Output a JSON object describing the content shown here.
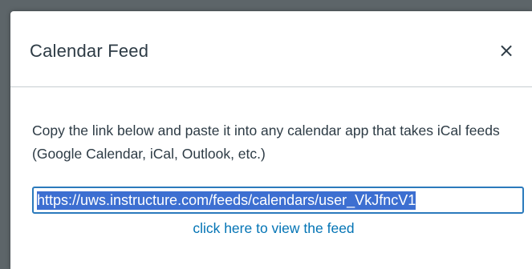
{
  "dialog": {
    "title": "Calendar Feed",
    "close_label": "×",
    "instructions": "Copy the link below and paste it into any calendar app that takes iCal feeds (Google Calendar, iCal, Outlook, etc.)",
    "feed_url": "https://uws.instructure.com/feeds/calendars/user_VkJfncV1",
    "view_feed_link": "click here to view the feed"
  },
  "colors": {
    "link": "#0374b5",
    "selection": "#3d6fd1",
    "focus_border": "#2b7abc",
    "text": "#2d3b45"
  }
}
